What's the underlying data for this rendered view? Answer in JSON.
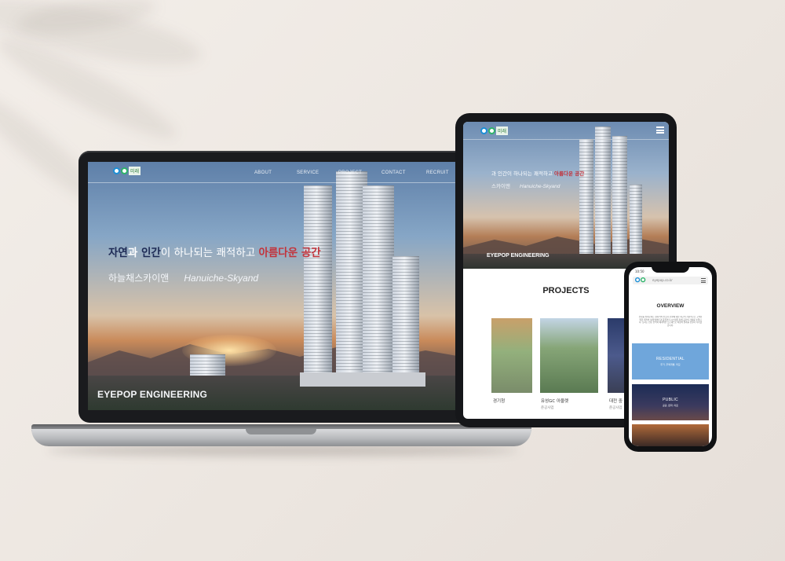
{
  "laptop": {
    "logo_text": "미래",
    "nav": [
      "ABOUT",
      "SERVICE",
      "PROJECT",
      "CONTACT",
      "RECRUIT"
    ],
    "headline": {
      "w1": "자연",
      "w2": "과 ",
      "w3": "인간",
      "w4": "이 하나되는 쾌적하고 ",
      "w5": "아름다운 공간"
    },
    "subline_ko": "하늘채스카이앤",
    "subline_en": "Hanuiche-Skyand",
    "brand": "EYEPOP ENGINEERING"
  },
  "tablet": {
    "logo_text": "미래",
    "headline_part1": "과 인간이 하나되는 쾌적하고 ",
    "headline_part2": "아름다운 공간",
    "sub_ko": "스카이앤",
    "sub_en": "Hanuiche-Skyand",
    "brand": "EYEPOP ENGINEERING",
    "section_title": "PROJECTS",
    "projects": [
      {
        "name": "경기청",
        "tag": ""
      },
      {
        "name": "유성GC 아울렛",
        "tag": "준공사업"
      },
      {
        "name": "대전 중",
        "tag": "준공사업"
      }
    ]
  },
  "phone": {
    "status_time": "10:50",
    "url_text": "eyepop.co.kr",
    "section_title": "OVERVIEW",
    "body_text": "산자를 위치로하는 원지역의 인프라 건설에 대한 최고의 기술력으로 고객을 위한 최적의 설계 방법론과 품질관리 시스템을 통해 공간의 가치를 높입니다. 당사는 전문 인력과 체계적인 프로세스로 최상의 결과를 만들어 나가겠습니다.",
    "cards": [
      {
        "title": "RESIDENTIAL",
        "sub": "주거, 주택개발, 리모"
      },
      {
        "title": "PUBLIC",
        "sub": "공공, 문화, 의료"
      }
    ]
  },
  "colors": {
    "accent_navy": "#1d2a55",
    "accent_red": "#c2343c",
    "card_blue": "#6fa6db"
  }
}
